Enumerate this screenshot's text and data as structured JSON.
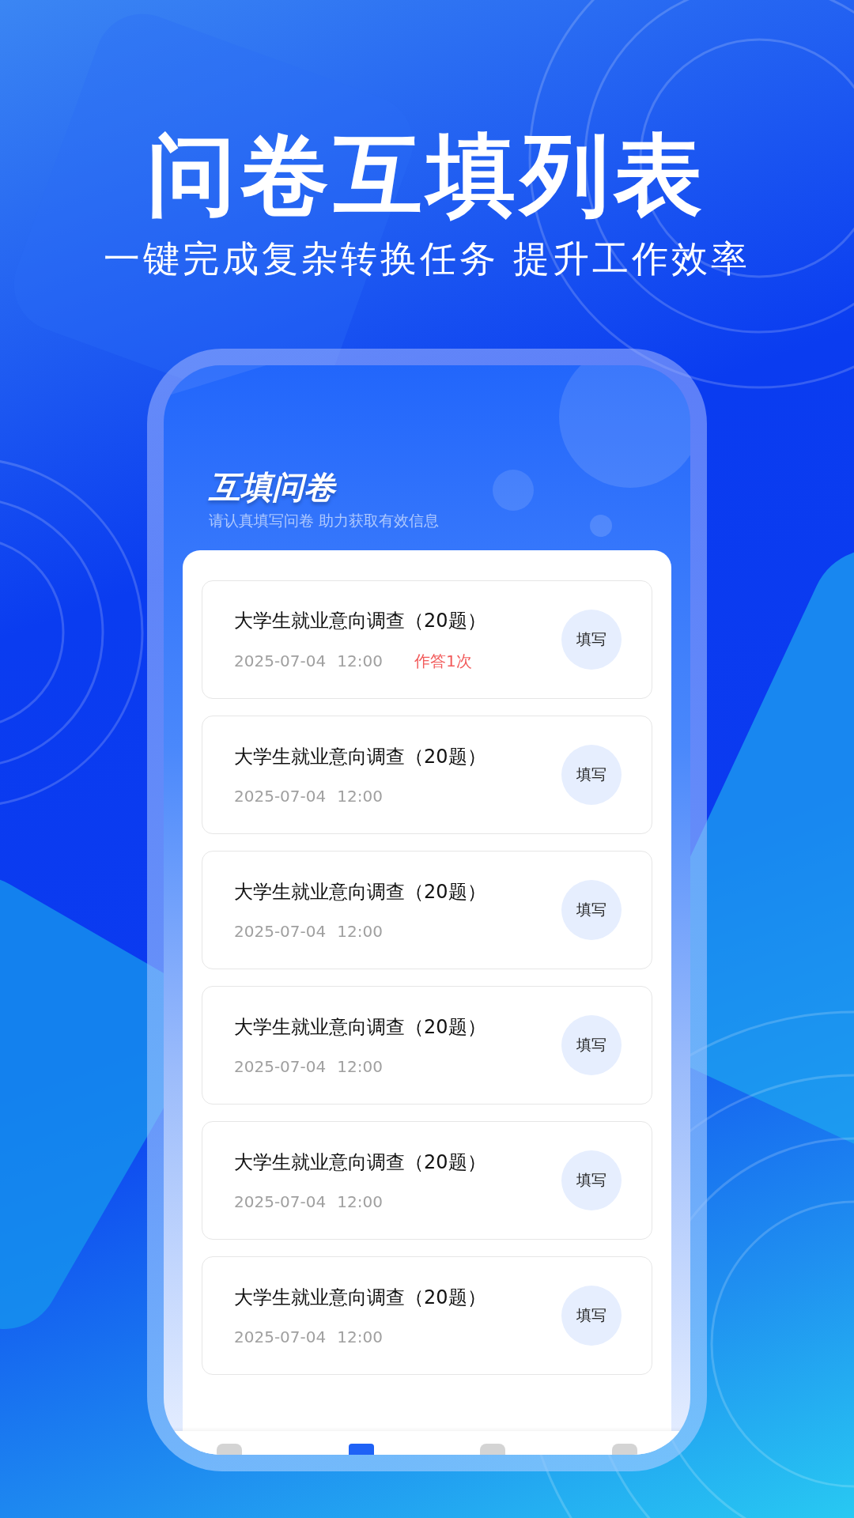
{
  "headline": "问卷互填列表",
  "tagline": "一键完成复杂转换任务 提升工作效率",
  "screen": {
    "title": "互填问卷",
    "subtitle": "请认真填写问卷 助力获取有效信息",
    "surveys": [
      {
        "title": "大学生就业意向调查（20题）",
        "date": "2025-07-04",
        "time": "12:00",
        "answered": "作答1次",
        "button": "填写"
      },
      {
        "title": "大学生就业意向调查（20题）",
        "date": "2025-07-04",
        "time": "12:00",
        "button": "填写"
      },
      {
        "title": "大学生就业意向调查（20题）",
        "date": "2025-07-04",
        "time": "12:00",
        "button": "填写"
      },
      {
        "title": "大学生就业意向调查（20题）",
        "date": "2025-07-04",
        "time": "12:00",
        "button": "填写"
      },
      {
        "title": "大学生就业意向调查（20题）",
        "date": "2025-07-04",
        "time": "12:00",
        "button": "填写"
      },
      {
        "title": "大学生就业意向调查（20题）",
        "date": "2025-07-04",
        "time": "12:00",
        "button": "填写"
      }
    ],
    "tab_bar": [
      {
        "selected": false
      },
      {
        "selected": true
      },
      {
        "selected": false
      },
      {
        "selected": false
      }
    ]
  }
}
